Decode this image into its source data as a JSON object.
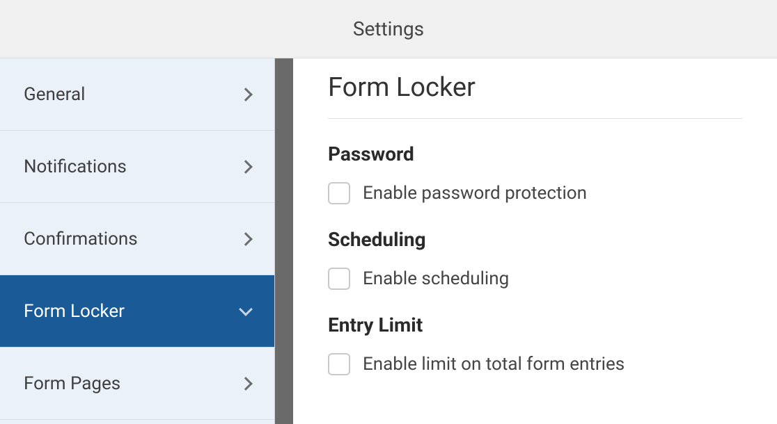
{
  "header": {
    "title": "Settings"
  },
  "sidebar": {
    "items": [
      {
        "label": "General",
        "active": false
      },
      {
        "label": "Notifications",
        "active": false
      },
      {
        "label": "Confirmations",
        "active": false
      },
      {
        "label": "Form Locker",
        "active": true
      },
      {
        "label": "Form Pages",
        "active": false
      }
    ]
  },
  "content": {
    "page_title": "Form Locker",
    "sections": {
      "password": {
        "heading": "Password",
        "checkbox_label": "Enable password protection"
      },
      "scheduling": {
        "heading": "Scheduling",
        "checkbox_label": "Enable scheduling"
      },
      "entry_limit": {
        "heading": "Entry Limit",
        "checkbox_label": "Enable limit on total form entries"
      }
    }
  }
}
